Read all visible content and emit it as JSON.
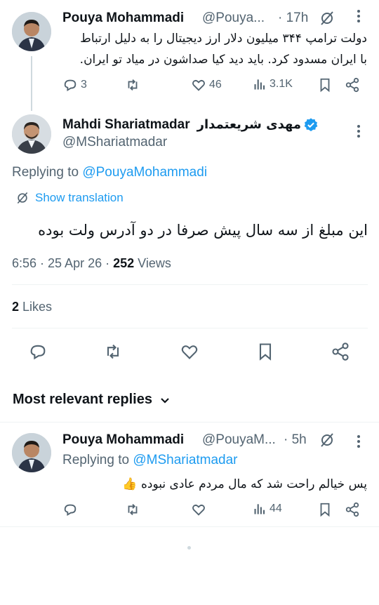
{
  "tweet1": {
    "author_name": "Pouya Mohammadi",
    "author_handle": "@Pouya...",
    "time": "· 17h",
    "text_line1": "دولت ترامپ ۳۴۴ میلیون دلار ارز دیجیتال را به دلیل ارتباط",
    "text_line2": "با ایران مسدود کرد. باید دید کیا صداشون در میاد تو ایران.",
    "replies": "3",
    "likes": "46",
    "views": "3.1K"
  },
  "main": {
    "author_name": "Mahdi Shariatmadar",
    "author_name_fa": "مهدی شریعتمدار",
    "author_handle": "@MShariatmadar",
    "replying_prefix": "Replying to ",
    "replying_to": "@PouyaMohammadi",
    "show_translation": "Show translation",
    "text": "این مبلغ از سه سال پیش صرفا در دو آدرس ولت بوده",
    "timestamp": "6:56 · 25 Apr 26 · ",
    "views_count": "252",
    "views_label": " Views",
    "likes_count": "2",
    "likes_label": " Likes"
  },
  "sort": {
    "label": "Most relevant replies"
  },
  "reply1": {
    "author_name": "Pouya Mohammadi",
    "author_handle": "@PouyaM...",
    "time": "· 5h",
    "replying_prefix": "Replying to ",
    "replying_to": "@MShariatmadar",
    "text": "پس خیالم راحت شد که مال مردم عادی نبوده 👍",
    "views": "44"
  },
  "colors": {
    "accent": "#1d9bf0",
    "secondary_text": "#536471",
    "primary_text": "#0f1419",
    "divider": "#eff3f4"
  }
}
